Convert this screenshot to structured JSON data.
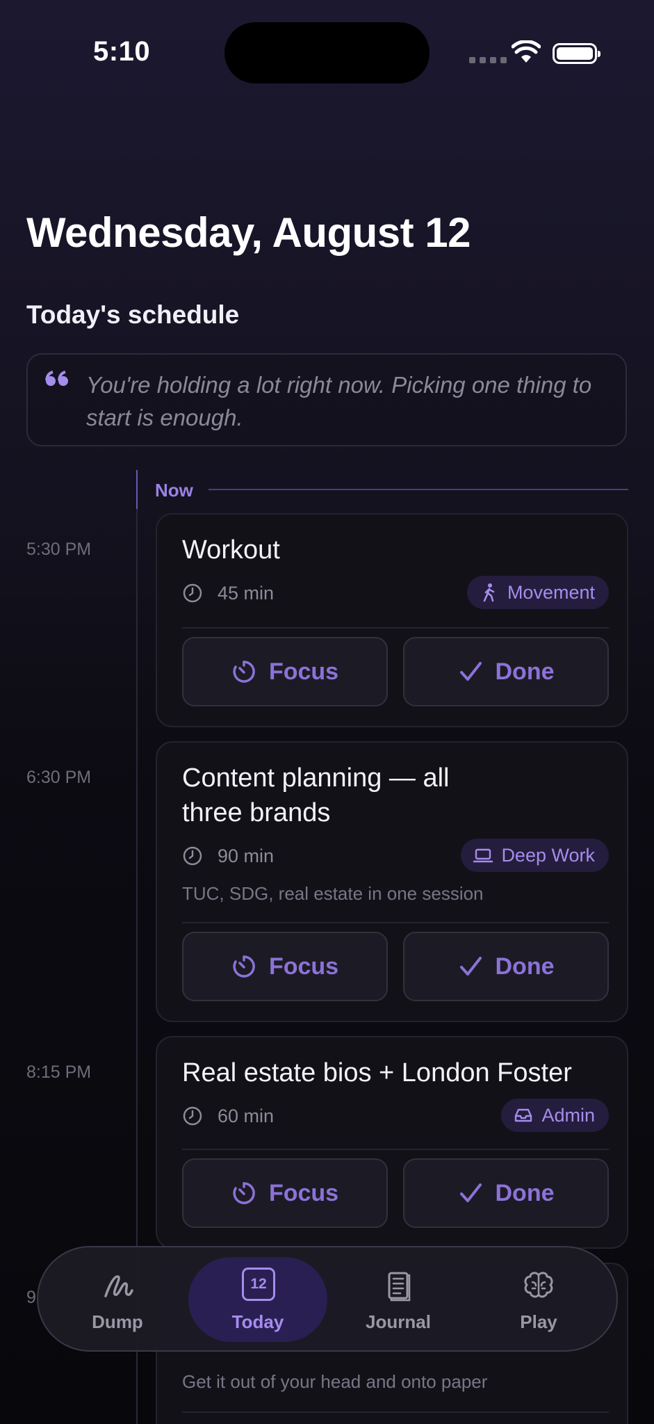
{
  "status_bar": {
    "time": "5:10"
  },
  "header": {
    "date": "Wednesday, August 12"
  },
  "schedule": {
    "title": "Today's schedule",
    "quote": "You're holding a lot right now. Picking one thing to start is enough.",
    "now_label": "Now"
  },
  "tasks": [
    {
      "time": "5:30 PM",
      "title": "Workout",
      "duration": "45 min",
      "tag": "Movement",
      "tag_icon": "walking-person-icon",
      "note": ""
    },
    {
      "time": "6:30 PM",
      "title": "Content planning — all three brands",
      "duration": "90 min",
      "tag": "Deep Work",
      "tag_icon": "laptop-icon",
      "note": "TUC, SDG, real estate in one session"
    },
    {
      "time": "8:15 PM",
      "title": "Real estate bios + London Foster",
      "duration": "60 min",
      "tag": "Admin",
      "tag_icon": "inbox-icon",
      "note": ""
    },
    {
      "time": "9",
      "title": "",
      "duration": "",
      "tag": "",
      "note": "Get it out of your head and onto paper"
    }
  ],
  "actions": {
    "focus": "Focus",
    "done": "Done"
  },
  "tabbar": {
    "items": [
      {
        "label": "Dump",
        "icon": "scribble-icon"
      },
      {
        "label": "Today",
        "icon": "calendar-icon",
        "icon_text": "12",
        "active": true
      },
      {
        "label": "Journal",
        "icon": "notebook-icon"
      },
      {
        "label": "Play",
        "icon": "brain-icon"
      }
    ]
  },
  "colors": {
    "accent": "#a58ded",
    "background": "#0c0b12",
    "card": "#121118"
  }
}
